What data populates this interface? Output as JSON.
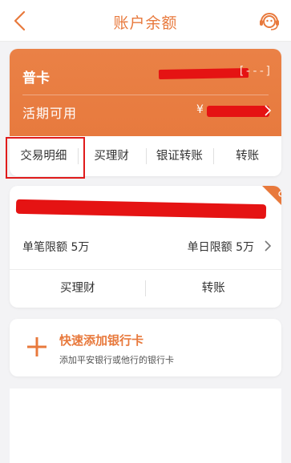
{
  "header": {
    "title": "账户余额",
    "back_icon": "chevron-left-icon",
    "service_icon": "customer-service-icon",
    "accent": "#e8793c"
  },
  "account_card": {
    "card_type": "普卡",
    "card_number_masked": "[---]",
    "balance_label": "活期可用",
    "currency_symbol": "¥",
    "actions": [
      "交易明细",
      "买理财",
      "银证转账",
      "转账"
    ],
    "highlight_color": "#e01b1b",
    "card_color": "#e77a3e"
  },
  "bank_card": {
    "single_limit": "单笔限额 5万",
    "daily_limit": "单日限额 5万",
    "actions": [
      "买理财",
      "转账"
    ]
  },
  "add_card": {
    "title": "快速添加银行卡",
    "subtitle": "添加平安银行或他行的银行卡"
  }
}
